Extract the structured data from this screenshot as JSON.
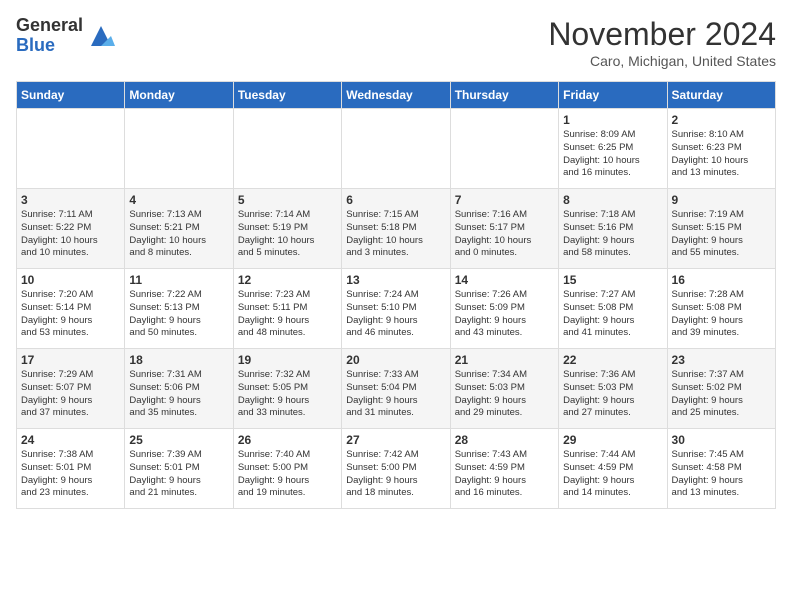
{
  "logo": {
    "general": "General",
    "blue": "Blue"
  },
  "title": "November 2024",
  "location": "Caro, Michigan, United States",
  "days_header": [
    "Sunday",
    "Monday",
    "Tuesday",
    "Wednesday",
    "Thursday",
    "Friday",
    "Saturday"
  ],
  "weeks": [
    [
      {
        "day": "",
        "info": ""
      },
      {
        "day": "",
        "info": ""
      },
      {
        "day": "",
        "info": ""
      },
      {
        "day": "",
        "info": ""
      },
      {
        "day": "",
        "info": ""
      },
      {
        "day": "1",
        "info": "Sunrise: 8:09 AM\nSunset: 6:25 PM\nDaylight: 10 hours\nand 16 minutes."
      },
      {
        "day": "2",
        "info": "Sunrise: 8:10 AM\nSunset: 6:23 PM\nDaylight: 10 hours\nand 13 minutes."
      }
    ],
    [
      {
        "day": "3",
        "info": "Sunrise: 7:11 AM\nSunset: 5:22 PM\nDaylight: 10 hours\nand 10 minutes."
      },
      {
        "day": "4",
        "info": "Sunrise: 7:13 AM\nSunset: 5:21 PM\nDaylight: 10 hours\nand 8 minutes."
      },
      {
        "day": "5",
        "info": "Sunrise: 7:14 AM\nSunset: 5:19 PM\nDaylight: 10 hours\nand 5 minutes."
      },
      {
        "day": "6",
        "info": "Sunrise: 7:15 AM\nSunset: 5:18 PM\nDaylight: 10 hours\nand 3 minutes."
      },
      {
        "day": "7",
        "info": "Sunrise: 7:16 AM\nSunset: 5:17 PM\nDaylight: 10 hours\nand 0 minutes."
      },
      {
        "day": "8",
        "info": "Sunrise: 7:18 AM\nSunset: 5:16 PM\nDaylight: 9 hours\nand 58 minutes."
      },
      {
        "day": "9",
        "info": "Sunrise: 7:19 AM\nSunset: 5:15 PM\nDaylight: 9 hours\nand 55 minutes."
      }
    ],
    [
      {
        "day": "10",
        "info": "Sunrise: 7:20 AM\nSunset: 5:14 PM\nDaylight: 9 hours\nand 53 minutes."
      },
      {
        "day": "11",
        "info": "Sunrise: 7:22 AM\nSunset: 5:13 PM\nDaylight: 9 hours\nand 50 minutes."
      },
      {
        "day": "12",
        "info": "Sunrise: 7:23 AM\nSunset: 5:11 PM\nDaylight: 9 hours\nand 48 minutes."
      },
      {
        "day": "13",
        "info": "Sunrise: 7:24 AM\nSunset: 5:10 PM\nDaylight: 9 hours\nand 46 minutes."
      },
      {
        "day": "14",
        "info": "Sunrise: 7:26 AM\nSunset: 5:09 PM\nDaylight: 9 hours\nand 43 minutes."
      },
      {
        "day": "15",
        "info": "Sunrise: 7:27 AM\nSunset: 5:08 PM\nDaylight: 9 hours\nand 41 minutes."
      },
      {
        "day": "16",
        "info": "Sunrise: 7:28 AM\nSunset: 5:08 PM\nDaylight: 9 hours\nand 39 minutes."
      }
    ],
    [
      {
        "day": "17",
        "info": "Sunrise: 7:29 AM\nSunset: 5:07 PM\nDaylight: 9 hours\nand 37 minutes."
      },
      {
        "day": "18",
        "info": "Sunrise: 7:31 AM\nSunset: 5:06 PM\nDaylight: 9 hours\nand 35 minutes."
      },
      {
        "day": "19",
        "info": "Sunrise: 7:32 AM\nSunset: 5:05 PM\nDaylight: 9 hours\nand 33 minutes."
      },
      {
        "day": "20",
        "info": "Sunrise: 7:33 AM\nSunset: 5:04 PM\nDaylight: 9 hours\nand 31 minutes."
      },
      {
        "day": "21",
        "info": "Sunrise: 7:34 AM\nSunset: 5:03 PM\nDaylight: 9 hours\nand 29 minutes."
      },
      {
        "day": "22",
        "info": "Sunrise: 7:36 AM\nSunset: 5:03 PM\nDaylight: 9 hours\nand 27 minutes."
      },
      {
        "day": "23",
        "info": "Sunrise: 7:37 AM\nSunset: 5:02 PM\nDaylight: 9 hours\nand 25 minutes."
      }
    ],
    [
      {
        "day": "24",
        "info": "Sunrise: 7:38 AM\nSunset: 5:01 PM\nDaylight: 9 hours\nand 23 minutes."
      },
      {
        "day": "25",
        "info": "Sunrise: 7:39 AM\nSunset: 5:01 PM\nDaylight: 9 hours\nand 21 minutes."
      },
      {
        "day": "26",
        "info": "Sunrise: 7:40 AM\nSunset: 5:00 PM\nDaylight: 9 hours\nand 19 minutes."
      },
      {
        "day": "27",
        "info": "Sunrise: 7:42 AM\nSunset: 5:00 PM\nDaylight: 9 hours\nand 18 minutes."
      },
      {
        "day": "28",
        "info": "Sunrise: 7:43 AM\nSunset: 4:59 PM\nDaylight: 9 hours\nand 16 minutes."
      },
      {
        "day": "29",
        "info": "Sunrise: 7:44 AM\nSunset: 4:59 PM\nDaylight: 9 hours\nand 14 minutes."
      },
      {
        "day": "30",
        "info": "Sunrise: 7:45 AM\nSunset: 4:58 PM\nDaylight: 9 hours\nand 13 minutes."
      }
    ]
  ]
}
